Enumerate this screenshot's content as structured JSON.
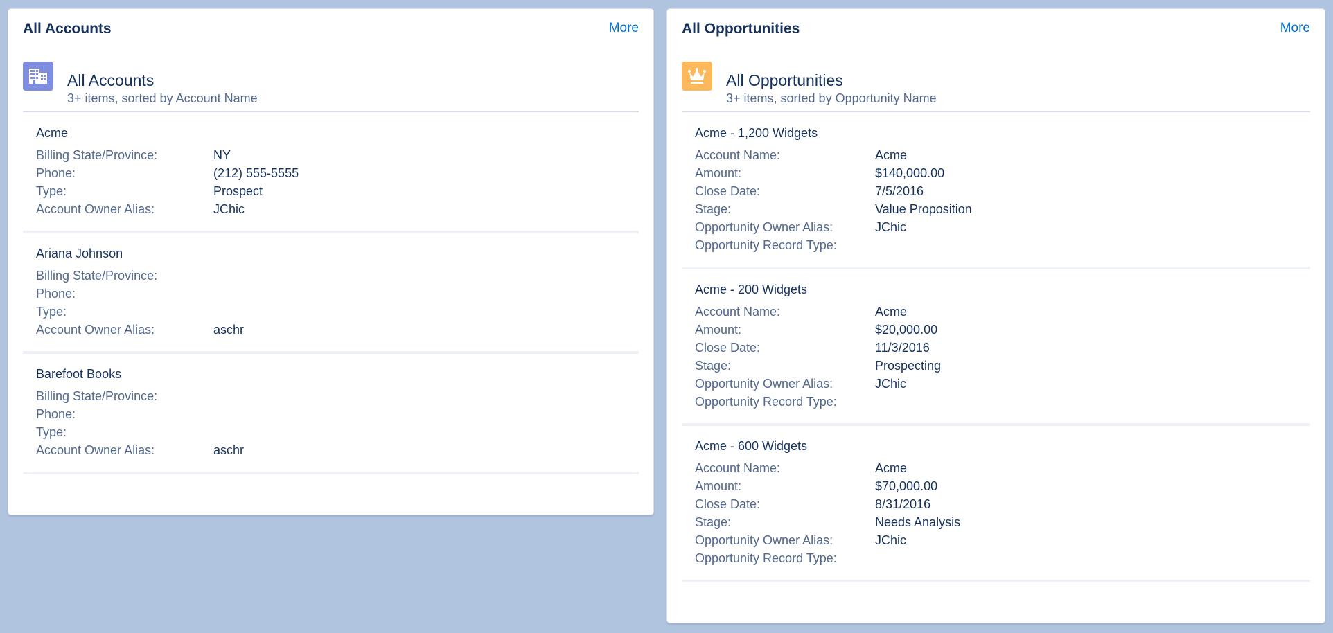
{
  "accounts_card": {
    "title": "All Accounts",
    "more_label": "More",
    "list_title": "All Accounts",
    "list_subtitle": "3+ items, sorted by Account Name",
    "icon": "building-icon",
    "icon_color": "#7f8de1",
    "records": [
      {
        "name": "Acme",
        "fields": [
          {
            "label": "Billing State/Province:",
            "value": "NY"
          },
          {
            "label": "Phone:",
            "value": "(212) 555-5555"
          },
          {
            "label": "Type:",
            "value": "Prospect"
          },
          {
            "label": "Account Owner Alias:",
            "value": "JChic"
          }
        ]
      },
      {
        "name": "Ariana Johnson",
        "fields": [
          {
            "label": "Billing State/Province:",
            "value": ""
          },
          {
            "label": "Phone:",
            "value": ""
          },
          {
            "label": "Type:",
            "value": ""
          },
          {
            "label": "Account Owner Alias:",
            "value": "aschr"
          }
        ]
      },
      {
        "name": "Barefoot Books",
        "fields": [
          {
            "label": "Billing State/Province:",
            "value": ""
          },
          {
            "label": "Phone:",
            "value": ""
          },
          {
            "label": "Type:",
            "value": ""
          },
          {
            "label": "Account Owner Alias:",
            "value": "aschr"
          }
        ]
      }
    ]
  },
  "opportunities_card": {
    "title": "All Opportunities",
    "more_label": "More",
    "list_title": "All Opportunities",
    "list_subtitle": "3+ items, sorted by Opportunity Name",
    "icon": "crown-icon",
    "icon_color": "#fcb95b",
    "records": [
      {
        "name": "Acme - 1,200 Widgets",
        "fields": [
          {
            "label": "Account Name:",
            "value": "Acme"
          },
          {
            "label": "Amount:",
            "value": "$140,000.00"
          },
          {
            "label": "Close Date:",
            "value": "7/5/2016"
          },
          {
            "label": "Stage:",
            "value": "Value Proposition"
          },
          {
            "label": "Opportunity Owner Alias:",
            "value": "JChic"
          },
          {
            "label": "Opportunity Record Type:",
            "value": ""
          }
        ]
      },
      {
        "name": "Acme - 200 Widgets",
        "fields": [
          {
            "label": "Account Name:",
            "value": "Acme"
          },
          {
            "label": "Amount:",
            "value": "$20,000.00"
          },
          {
            "label": "Close Date:",
            "value": "11/3/2016"
          },
          {
            "label": "Stage:",
            "value": "Prospecting"
          },
          {
            "label": "Opportunity Owner Alias:",
            "value": "JChic"
          },
          {
            "label": "Opportunity Record Type:",
            "value": ""
          }
        ]
      },
      {
        "name": "Acme - 600 Widgets",
        "fields": [
          {
            "label": "Account Name:",
            "value": "Acme"
          },
          {
            "label": "Amount:",
            "value": "$70,000.00"
          },
          {
            "label": "Close Date:",
            "value": "8/31/2016"
          },
          {
            "label": "Stage:",
            "value": "Needs Analysis"
          },
          {
            "label": "Opportunity Owner Alias:",
            "value": "JChic"
          },
          {
            "label": "Opportunity Record Type:",
            "value": ""
          }
        ]
      }
    ]
  }
}
